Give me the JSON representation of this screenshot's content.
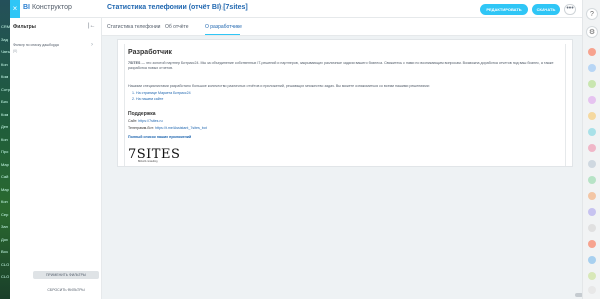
{
  "app": {
    "close_label": "×",
    "title_brand": "BI",
    "title_rest": "Конструктор",
    "report_title": "Статистика телефонии (отчёт BI) [7sites]",
    "star": "☆"
  },
  "toolbar": {
    "edit_label": "РЕДАКТИРОВАТЬ",
    "save_label": "СКАЧАТЬ",
    "more_label": "•••"
  },
  "filters": {
    "title": "Фильтры",
    "collapse_icon": "|←",
    "item_text": "Фильтр по списку дашборда",
    "item_count": "(0)",
    "chevron": "›",
    "apply_label": "ПРИМЕНИТЬ ФИЛЬТРЫ",
    "reset_label": "СБРОСИТЬ ФИЛЬТРЫ"
  },
  "tabs": [
    {
      "label": "Статистика телефонии"
    },
    {
      "label": "Об отчёте"
    },
    {
      "label": "О разработчике"
    }
  ],
  "developer": {
    "heading": "Разработчик",
    "para1_bold": "7SITES",
    "para1": " — это золотой партнер Битрикс24. Мы за объединение собственных IT-решений и партнеров, закрывающих различные задачи вашего бизнеса. Свяжитесь с нами по возникающим вопросам. Возможна доработка отчетов под ваш бизнес, а также разработка новых отчетов.",
    "para2": "Нашими специалистами разработано большое количество различных отчётов и приложений, решающих множество задач. Вы можете ознакомиться со всеми нашими решениями:",
    "links": [
      "1. На странице Маркета Битрикс24",
      "2. На нашем сайте"
    ],
    "support_heading": "Поддержка",
    "site_label": "Сайт: ",
    "site_value": "https://7sites.ru",
    "tg_label": "Телеграмм-бот: ",
    "tg_value": "https://t.me/Assistant_7sites_bot",
    "apps_link": "Полный список наших приложений",
    "logo_big": "7SITES",
    "logo_small": "Bitrix24 consulting"
  },
  "left_strip": [
    "CRM",
    "Зад",
    "Чаты",
    "Кон",
    "Ком",
    "Сотр",
    "Биз",
    "Ком",
    "Ден",
    "Кон",
    "Про",
    "Мар",
    "Сай",
    "Мар",
    "Кон",
    "Сер",
    "Зап",
    "Дох",
    "Воз",
    "CLO",
    "CLO"
  ]
}
